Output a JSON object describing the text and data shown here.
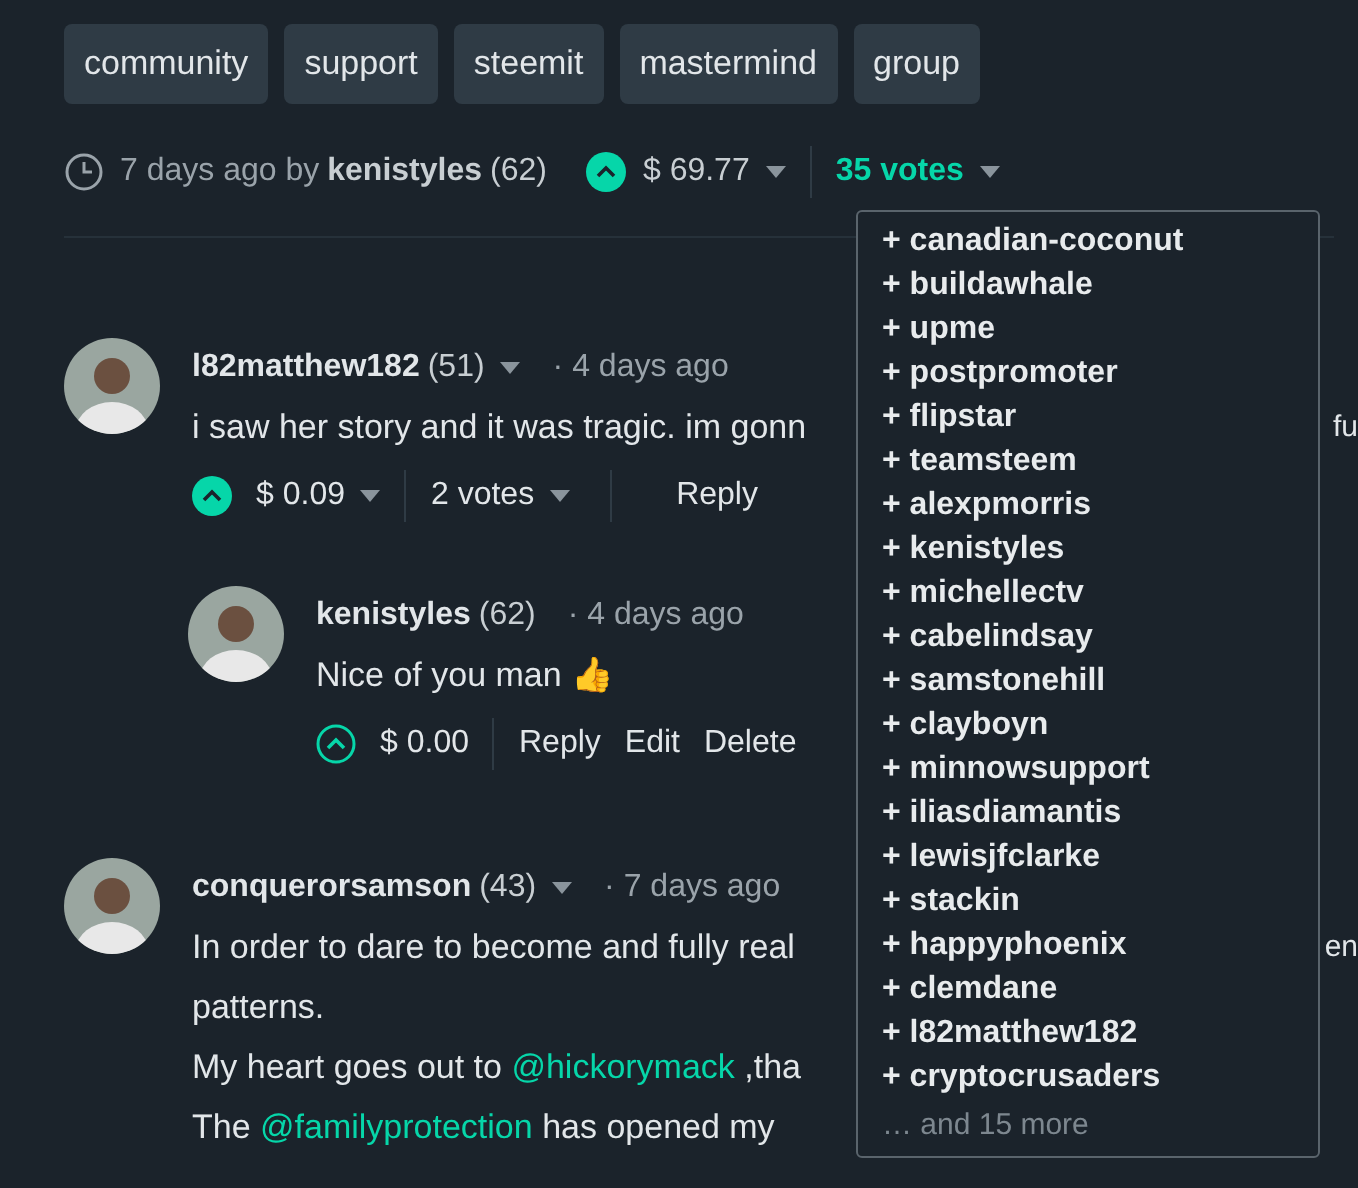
{
  "tags": [
    "community",
    "support",
    "steemit",
    "mastermind",
    "group"
  ],
  "post_meta": {
    "time": "7 days ago by",
    "author": "kenistyles",
    "reputation": "(62)",
    "payout": "$ 69.77",
    "votes": "35 votes",
    "upvoted": true
  },
  "voters_dropdown": {
    "voters": [
      "+ canadian-coconut",
      "+ buildawhale",
      "+ upme",
      "+ postpromoter",
      "+ flipstar",
      "+ teamsteem",
      "+ alexpmorris",
      "+ kenistyles",
      "+ michellectv",
      "+ cabelindsay",
      "+ samstonehill",
      "+ clayboyn",
      "+ minnowsupport",
      "+ iliasdiamantis",
      "+ lewisjfclarke",
      "+ stackin",
      "+ happyphoenix",
      "+ clemdane",
      "+ l82matthew182",
      "+ cryptocrusaders"
    ],
    "more": "… and 15 more"
  },
  "comments": [
    {
      "author": "l82matthew182",
      "reputation": "(51)",
      "time": "· 4 days ago",
      "nested": false,
      "lines": [
        {
          "parts": [
            {
              "kind": "text",
              "text": "i saw her story and it was tragic. im gonn"
            }
          ],
          "tail": "fu"
        }
      ],
      "payout": "$ 0.09",
      "votes": "2 votes",
      "upvoted": true,
      "actions": [
        "Reply"
      ]
    },
    {
      "author": "kenistyles",
      "reputation": "(62)",
      "time": "· 4 days ago",
      "nested": true,
      "lines": [
        {
          "parts": [
            {
              "kind": "text",
              "text": "Nice of you man 👍"
            }
          ]
        }
      ],
      "payout": "$ 0.00",
      "upvoted": false,
      "actions": [
        "Reply",
        "Edit",
        "Delete"
      ]
    },
    {
      "author": "conquerorsamson",
      "reputation": "(43)",
      "time": "· 7 days ago",
      "nested": false,
      "lines": [
        {
          "parts": [
            {
              "kind": "text",
              "text": "In order to dare to become and fully real"
            }
          ],
          "tail": "en"
        },
        {
          "parts": [
            {
              "kind": "text",
              "text": "patterns."
            }
          ]
        },
        {
          "parts": [
            {
              "kind": "text",
              "text": "My heart goes out to "
            },
            {
              "kind": "link",
              "text": "@hickorymack"
            },
            {
              "kind": "text",
              "text": " ,tha"
            }
          ]
        },
        {
          "parts": [
            {
              "kind": "text",
              "text": "The "
            },
            {
              "kind": "link",
              "text": "@familyprotection"
            },
            {
              "kind": "text",
              "text": " has opened my"
            }
          ]
        }
      ]
    }
  ]
}
